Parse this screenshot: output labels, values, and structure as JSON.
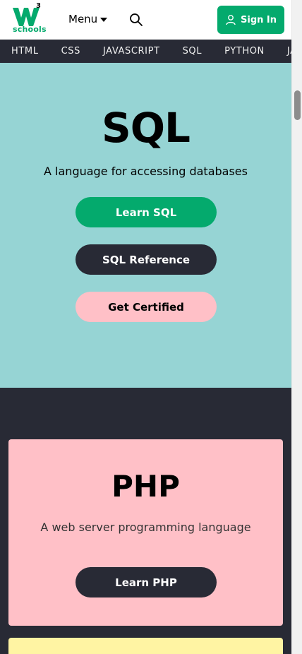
{
  "header": {
    "logo_mark": "W3",
    "logo_sup": "3",
    "logo_sub": "schools",
    "menu_label": "Menu",
    "signin_label": "Sign In"
  },
  "nav": {
    "items": [
      "HTML",
      "CSS",
      "JAVASCRIPT",
      "SQL",
      "PYTHON",
      "JAVA"
    ]
  },
  "hero": {
    "title": "SQL",
    "subtitle": "A language for accessing databases",
    "buttons": [
      "Learn SQL",
      "SQL Reference",
      "Get Certified"
    ]
  },
  "php_card": {
    "title": "PHP",
    "subtitle": "A web server programming language",
    "button": "Learn PHP"
  },
  "colors": {
    "brand_green": "#04AA6D",
    "dark": "#282A35",
    "hero_bg": "#96D4D4",
    "pink": "#FFC0C7",
    "yellow": "#FFF4A3"
  },
  "icons": {
    "search": "search-icon",
    "user": "user-icon",
    "caret": "caret-down-icon"
  }
}
